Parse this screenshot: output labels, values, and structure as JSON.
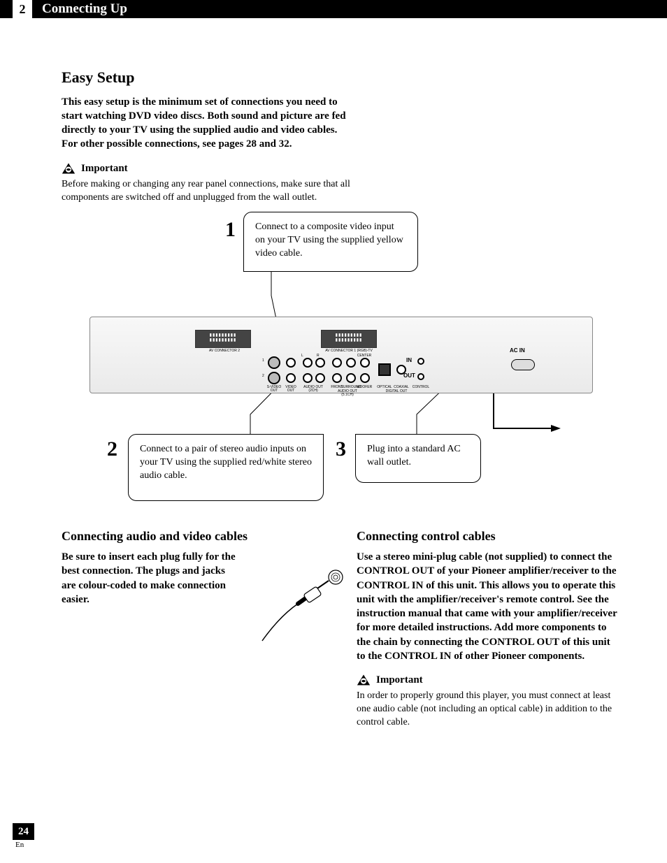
{
  "header": {
    "chapter_number": "2",
    "chapter_title": "Connecting Up"
  },
  "section": {
    "title": "Easy Setup",
    "intro_bold": "This easy setup is the minimum set of connections you need to start watching DVD video discs. Both sound and picture are fed directly to your TV using the supplied audio and video cables. For other possible connections, see ",
    "intro_ref": "pages 28 and 32.",
    "important_label": "Important",
    "important_text": "Before making or changing any rear panel connections, make sure that all components are switched off and unplugged from the wall outlet."
  },
  "callouts": {
    "c1_num": "1",
    "c1_text": "Connect to a composite video input on your TV using the supplied yellow video cable.",
    "c2_num": "2",
    "c2_text": "Connect to a pair of stereo audio inputs on your TV using the supplied red/white stereo audio cable.",
    "c3_num": "3",
    "c3_text": "Plug into a standard AC wall outlet."
  },
  "device_labels": {
    "av_conn2": "AV CONNECTOR 2",
    "av_conn1": "AV CONNECTOR 1 (RGB)-TV",
    "svideo": "S-VIDEO OUT",
    "video": "VIDEO OUT",
    "audio2ch": "AUDIO OUT (2CH)",
    "front": "FRONT",
    "surround": "SURROUND",
    "audio51": "AUDIO OUT (5.1CH)",
    "center": "CENTER",
    "woofer": "WOOFER",
    "optical": "OPTICAL",
    "coaxial": "COAXIAL",
    "digital": "DIGITAL OUT",
    "control": "CONTROL",
    "in": "IN",
    "out": "OUT",
    "acin": "AC IN",
    "l": "L",
    "r": "R",
    "row1": "1",
    "row2": "2"
  },
  "left_col": {
    "heading": "Connecting audio and video cables",
    "body": "Be sure to insert each plug fully for the best connection. The plugs and jacks are colour-coded to make connection easier."
  },
  "right_col": {
    "heading": "Connecting control cables",
    "body_1": "Use a stereo mini-plug cable (not supplied) to connect the ",
    "ctrl_out": "CONTROL OUT",
    "body_2": " of your Pioneer amplifier/receiver to the ",
    "ctrl_in": "CONTROL IN",
    "body_3": " of this unit. This allows you to operate this unit with the amplifier/receiver's remote control. See the instruction manual that came with your amplifier/receiver for more detailed instructions. Add more components to the chain by connecting the ",
    "ctrl_out2": "CONTROL OUT",
    "body_4": " of this unit to the ",
    "ctrl_in2": "CONTROL IN",
    "body_5": " of other Pioneer components.",
    "important_label": "Important",
    "important_text": "In order to properly ground this player, you must connect at least one audio cable (not including an optical cable) in addition to the control cable."
  },
  "footer": {
    "page": "24",
    "lang": "En"
  }
}
